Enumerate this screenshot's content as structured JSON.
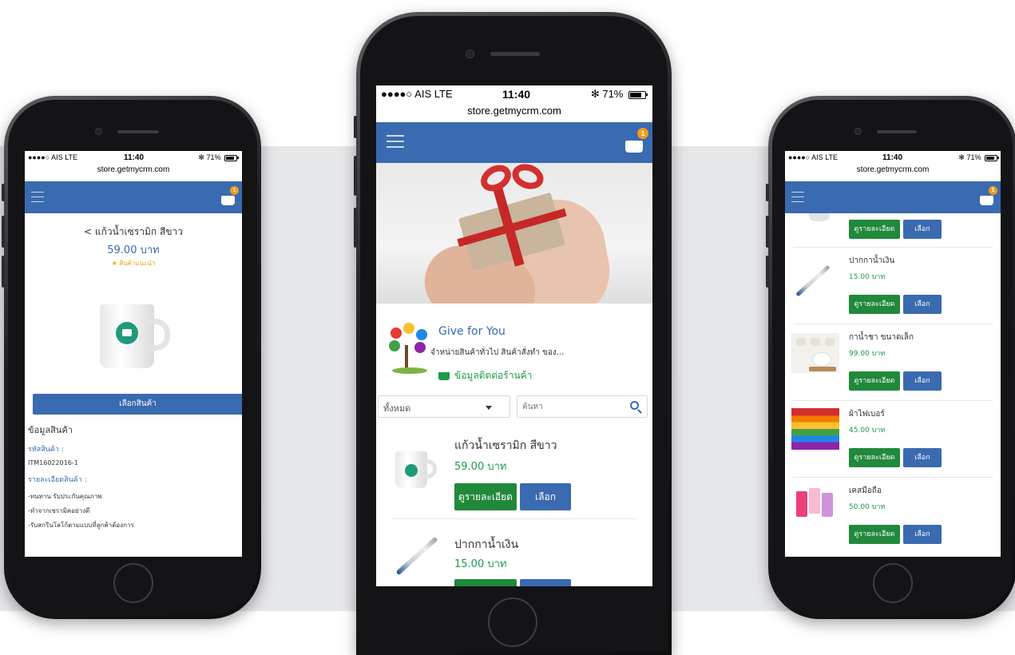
{
  "status": {
    "carrier": "●●●●○ AIS  LTE",
    "time": "11:40",
    "battery": "✻ 71%",
    "url": "store.getmycrm.com"
  },
  "cart_badge": "1",
  "left_screen": {
    "title": "< แก้วน้ำเซรามิก สีขาว",
    "price": "59.00 บาท",
    "featured": "★  สินค้าแนะนำ",
    "select_button": "เลือกสินค้า",
    "info_heading": "ข้อมูลสินค้า",
    "code_label": "รหัสสินค้า :",
    "code_value": "ITM16022016-1",
    "detail_label": "รายละเอียดสินค้า :",
    "details": [
      "-ทนทาน รับประกันคุณภาพ",
      "-ทำจากเซรามิคอย่างดี",
      "-รับสกรีนโลโก้ตามแบบที่ลูกค้าต้องการ"
    ]
  },
  "center_screen": {
    "shop_name": "Give for You",
    "shop_desc": "จำหน่ายสินค้าทั่วไป สินค้าสั่งทำ ของ...",
    "contact_link": "ข้อมูลติดต่อร้านค้า",
    "category_select": "ทั้งหมด",
    "search_placeholder": "ค้นหา",
    "products": [
      {
        "name": "แก้วน้ำเซรามิก สีขาว",
        "price": "59.00 บาท",
        "detail_btn": "ดูรายละเอียด",
        "select_btn": "เลือก"
      },
      {
        "name": "ปากกาน้ำเงิน",
        "price": "15.00 บาท"
      }
    ]
  },
  "right_screen": {
    "top_buttons": {
      "detail_btn": "ดูรายละเอียด",
      "select_btn": "เลือก"
    },
    "products": [
      {
        "name": "ปากกาน้ำเงิน",
        "price": "15.00 บาท",
        "detail_btn": "ดูรายละเอียด",
        "select_btn": "เลือก"
      },
      {
        "name": "กาน้ำชา ขนาดเล็ก",
        "price": "99.00 บาท",
        "detail_btn": "ดูรายละเอียด",
        "select_btn": "เลือก"
      },
      {
        "name": "ผ้าไฟเบอร์",
        "price": "45.00 บาท",
        "detail_btn": "ดูรายละเอียด",
        "select_btn": "เลือก"
      },
      {
        "name": "เคสมือถือ",
        "price": "50.00 บาท",
        "detail_btn": "ดูรายละเอียด",
        "select_btn": "เลือก"
      }
    ]
  }
}
